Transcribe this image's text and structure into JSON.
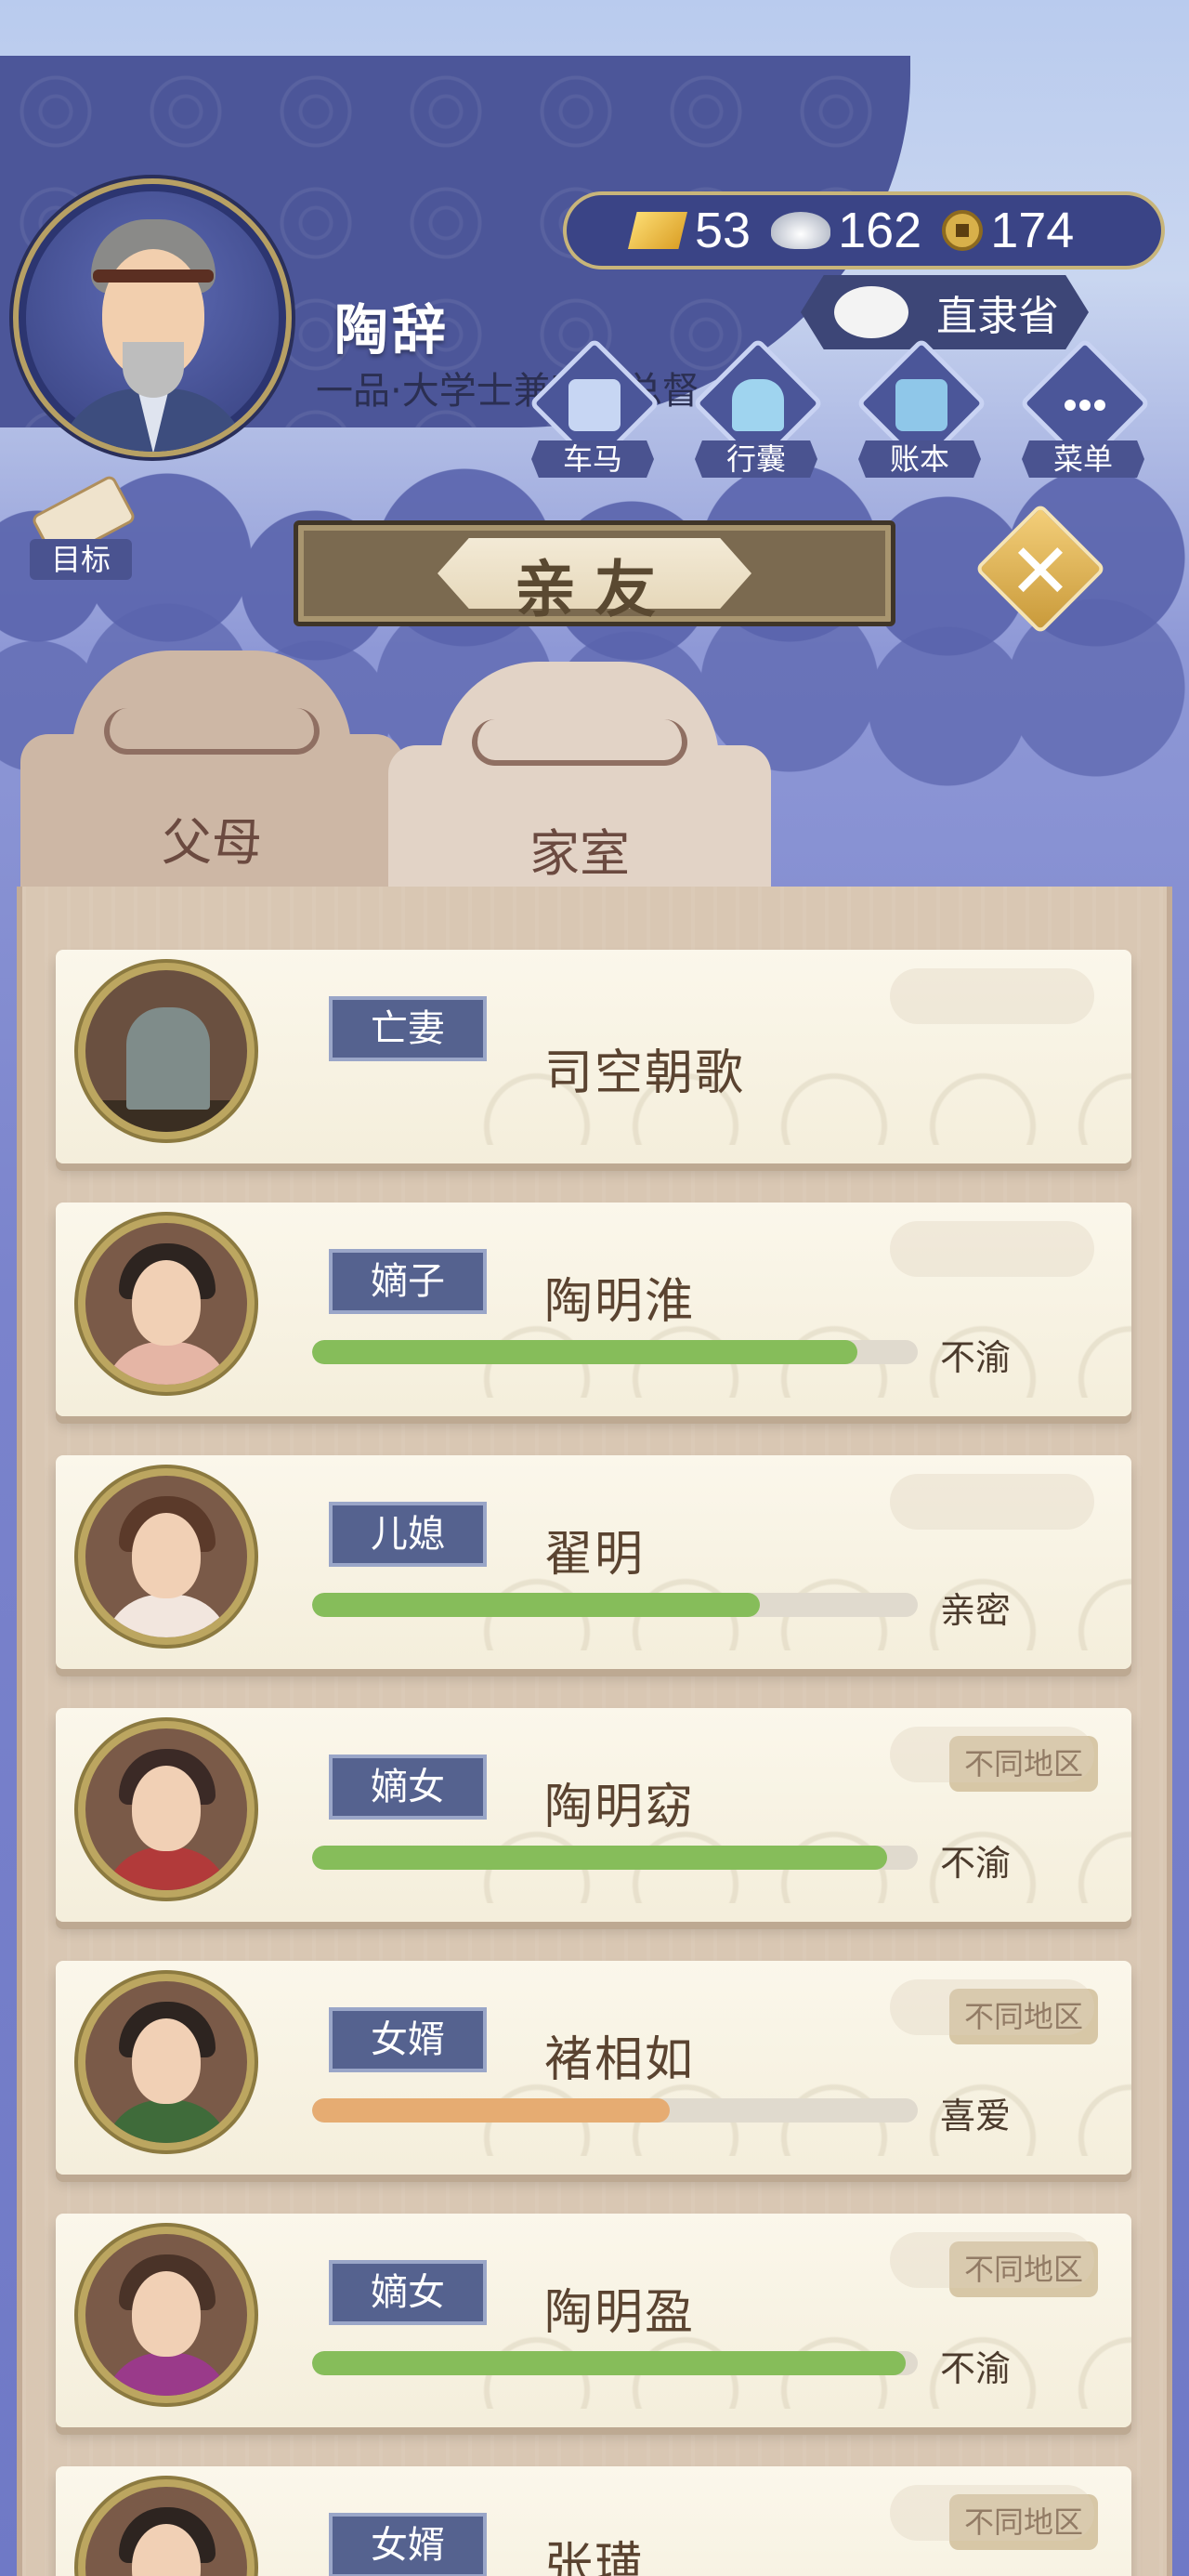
{
  "player": {
    "name": "陶辞",
    "title": "一品·大学士兼直隶总督"
  },
  "currency": {
    "gold": "53",
    "silver": "162",
    "copper": "174"
  },
  "region": "直隶省",
  "quick_menu": [
    {
      "label": "车马",
      "icon": "carriage-icon"
    },
    {
      "label": "行囊",
      "icon": "bundle-icon"
    },
    {
      "label": "账本",
      "icon": "ledger-icon"
    },
    {
      "label": "菜单",
      "icon": "more-icon"
    }
  ],
  "goal_label": "目标",
  "panel_title": "亲友",
  "tabs": [
    {
      "label": "父母",
      "active": false
    },
    {
      "label": "家室",
      "active": true
    }
  ],
  "relatives": [
    {
      "relation": "亡妻",
      "name": "司空朝歌",
      "mood": "",
      "affinity": null,
      "bar_color": "",
      "region_badge": ""
    },
    {
      "relation": "嫡子",
      "name": "陶明淮",
      "mood": "不渝",
      "affinity": 0.9,
      "bar_color": "#86bd5a",
      "region_badge": ""
    },
    {
      "relation": "儿媳",
      "name": "翟明",
      "mood": "亲密",
      "affinity": 0.74,
      "bar_color": "#86bd5a",
      "region_badge": ""
    },
    {
      "relation": "嫡女",
      "name": "陶明窈",
      "mood": "不渝",
      "affinity": 0.95,
      "bar_color": "#86bd5a",
      "region_badge": "不同地区"
    },
    {
      "relation": "女婿",
      "name": "褚相如",
      "mood": "喜爱",
      "affinity": 0.59,
      "bar_color": "#e6ac72",
      "region_badge": "不同地区"
    },
    {
      "relation": "嫡女",
      "name": "陶明盈",
      "mood": "不渝",
      "affinity": 0.98,
      "bar_color": "#86bd5a",
      "region_badge": "不同地区"
    },
    {
      "relation": "女婿",
      "name": "张璜",
      "mood": "",
      "affinity": null,
      "bar_color": "",
      "region_badge": "不同地区"
    }
  ]
}
